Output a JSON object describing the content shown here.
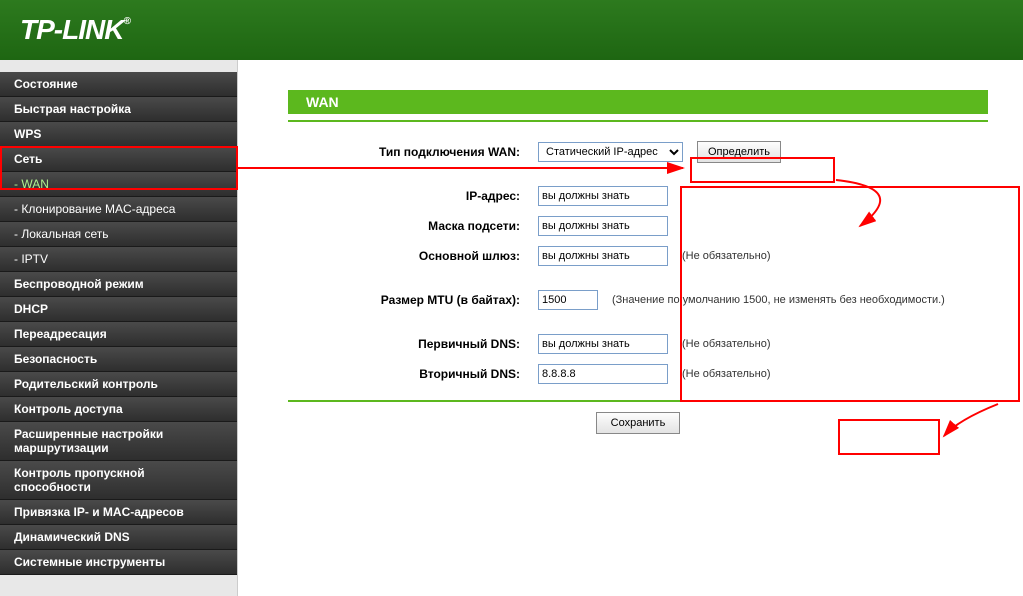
{
  "brand": "TP-LINK",
  "sidebar": {
    "items": [
      {
        "label": "Состояние",
        "type": "top"
      },
      {
        "label": "Быстрая настройка",
        "type": "top"
      },
      {
        "label": "WPS",
        "type": "top"
      },
      {
        "label": "Сеть",
        "type": "top",
        "selected": true
      },
      {
        "label": "- WAN",
        "type": "sub",
        "selected": true
      },
      {
        "label": "- Клонирование MAC-адреса",
        "type": "sub"
      },
      {
        "label": "- Локальная сеть",
        "type": "sub"
      },
      {
        "label": "- IPTV",
        "type": "sub"
      },
      {
        "label": "Беспроводной режим",
        "type": "top"
      },
      {
        "label": "DHCP",
        "type": "top"
      },
      {
        "label": "Переадресация",
        "type": "top"
      },
      {
        "label": "Безопасность",
        "type": "top"
      },
      {
        "label": "Родительский контроль",
        "type": "top"
      },
      {
        "label": "Контроль доступа",
        "type": "top"
      },
      {
        "label": "Расширенные настройки маршрутизации",
        "type": "top"
      },
      {
        "label": "Контроль пропускной способности",
        "type": "top"
      },
      {
        "label": "Привязка IP- и MAC-адресов",
        "type": "top"
      },
      {
        "label": "Динамический DNS",
        "type": "top"
      },
      {
        "label": "Системные инструменты",
        "type": "top"
      }
    ]
  },
  "page": {
    "title": "WAN",
    "save": "Сохранить"
  },
  "form": {
    "wan_type_label": "Тип подключения WAN:",
    "wan_type_value": "Статический IP-адрес",
    "detect_btn": "Определить",
    "ip_label": "IP-адрес:",
    "ip_value": "вы должны знать",
    "mask_label": "Маска подсети:",
    "mask_value": "вы должны знать",
    "gw_label": "Основной шлюз:",
    "gw_value": "вы должны знать",
    "mtu_label": "Размер MTU (в байтах):",
    "mtu_value": "1500",
    "mtu_hint": "(Значение по умолчанию 1500, не изменять без необходимости.)",
    "dns1_label": "Первичный DNS:",
    "dns1_value": "вы должны знать",
    "dns2_label": "Вторичный DNS:",
    "dns2_value": "8.8.8.8",
    "optional": "(Не обязательно)"
  }
}
